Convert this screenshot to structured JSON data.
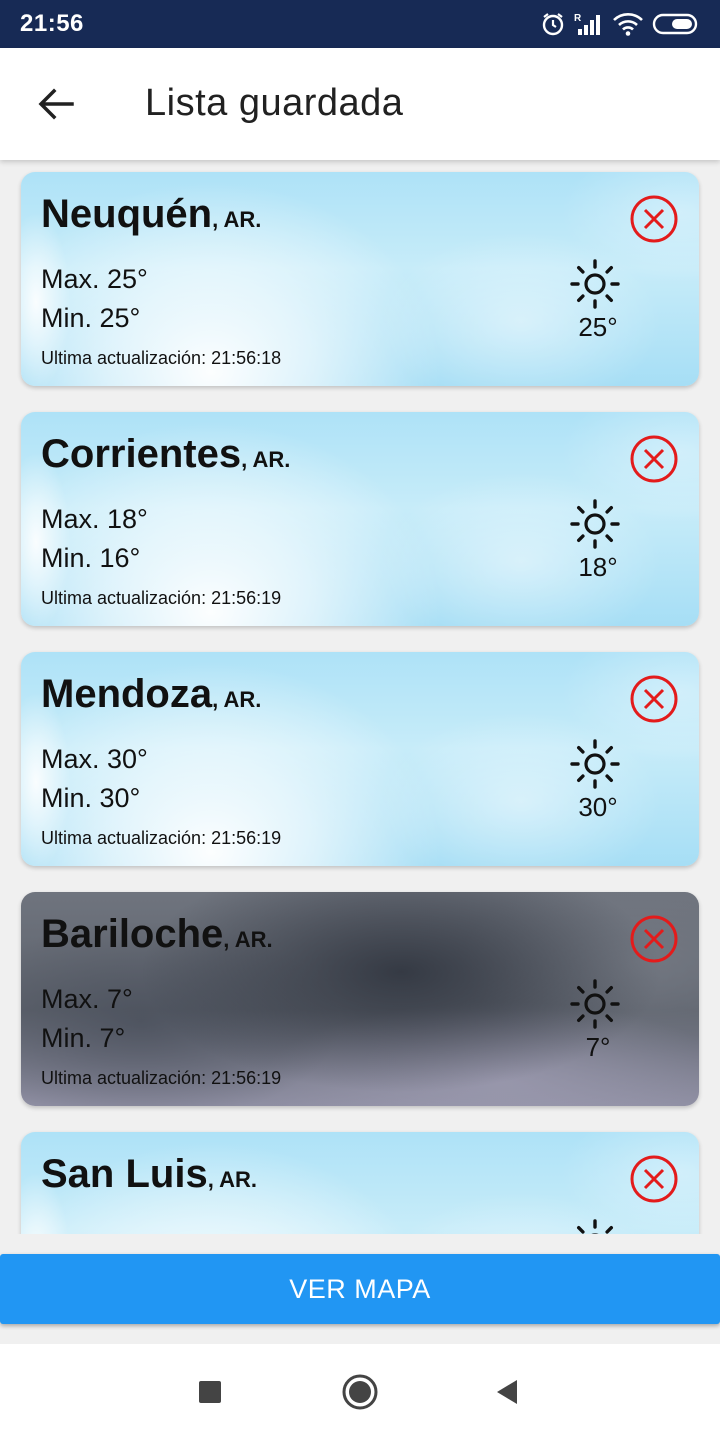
{
  "status_bar": {
    "time": "21:56",
    "icons": [
      "alarm-icon",
      "signal-icon",
      "wifi-icon",
      "battery-icon"
    ]
  },
  "app_bar": {
    "title": "Lista guardada",
    "back_icon": "arrow-left-icon"
  },
  "cities": [
    {
      "name": "Neuquén",
      "country": ", AR.",
      "max": "Max. 25°",
      "min": "Min. 25°",
      "updated": "Ultima actualización: 21:56:18",
      "temp": "25°",
      "weather_icon": "sun-icon",
      "background": "sunny"
    },
    {
      "name": "Corrientes",
      "country": ", AR.",
      "max": "Max. 18°",
      "min": "Min. 16°",
      "updated": "Ultima actualización: 21:56:19",
      "temp": "18°",
      "weather_icon": "sun-icon",
      "background": "sunny"
    },
    {
      "name": "Mendoza",
      "country": ", AR.",
      "max": "Max. 30°",
      "min": "Min. 30°",
      "updated": "Ultima actualización: 21:56:19",
      "temp": "30°",
      "weather_icon": "sun-icon",
      "background": "sunny"
    },
    {
      "name": "Bariloche",
      "country": ", AR.",
      "max": "Max. 7°",
      "min": "Min. 7°",
      "updated": "Ultima actualización: 21:56:19",
      "temp": "7°",
      "weather_icon": "sun-icon",
      "background": "cloudy"
    },
    {
      "name": "San Luis",
      "country": ", AR.",
      "weather_icon": "sun-icon",
      "background": "sunny"
    }
  ],
  "map_button": {
    "label": "VER MAPA"
  },
  "colors": {
    "status_bar": "#172a55",
    "accent": "#2196f3",
    "remove": "#e31b1b"
  },
  "nav_bar": {
    "icons": [
      "recents-square-icon",
      "home-circle-icon",
      "back-triangle-icon"
    ]
  }
}
